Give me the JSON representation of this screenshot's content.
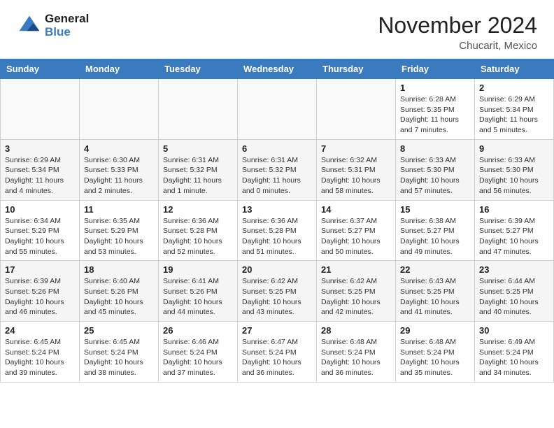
{
  "header": {
    "logo_general": "General",
    "logo_blue": "Blue",
    "month_title": "November 2024",
    "location": "Chucarit, Mexico"
  },
  "weekdays": [
    "Sunday",
    "Monday",
    "Tuesday",
    "Wednesday",
    "Thursday",
    "Friday",
    "Saturday"
  ],
  "weeks": [
    [
      {
        "day": "",
        "info": ""
      },
      {
        "day": "",
        "info": ""
      },
      {
        "day": "",
        "info": ""
      },
      {
        "day": "",
        "info": ""
      },
      {
        "day": "",
        "info": ""
      },
      {
        "day": "1",
        "info": "Sunrise: 6:28 AM\nSunset: 5:35 PM\nDaylight: 11 hours and 7 minutes."
      },
      {
        "day": "2",
        "info": "Sunrise: 6:29 AM\nSunset: 5:34 PM\nDaylight: 11 hours and 5 minutes."
      }
    ],
    [
      {
        "day": "3",
        "info": "Sunrise: 6:29 AM\nSunset: 5:34 PM\nDaylight: 11 hours and 4 minutes."
      },
      {
        "day": "4",
        "info": "Sunrise: 6:30 AM\nSunset: 5:33 PM\nDaylight: 11 hours and 2 minutes."
      },
      {
        "day": "5",
        "info": "Sunrise: 6:31 AM\nSunset: 5:32 PM\nDaylight: 11 hours and 1 minute."
      },
      {
        "day": "6",
        "info": "Sunrise: 6:31 AM\nSunset: 5:32 PM\nDaylight: 11 hours and 0 minutes."
      },
      {
        "day": "7",
        "info": "Sunrise: 6:32 AM\nSunset: 5:31 PM\nDaylight: 10 hours and 58 minutes."
      },
      {
        "day": "8",
        "info": "Sunrise: 6:33 AM\nSunset: 5:30 PM\nDaylight: 10 hours and 57 minutes."
      },
      {
        "day": "9",
        "info": "Sunrise: 6:33 AM\nSunset: 5:30 PM\nDaylight: 10 hours and 56 minutes."
      }
    ],
    [
      {
        "day": "10",
        "info": "Sunrise: 6:34 AM\nSunset: 5:29 PM\nDaylight: 10 hours and 55 minutes."
      },
      {
        "day": "11",
        "info": "Sunrise: 6:35 AM\nSunset: 5:29 PM\nDaylight: 10 hours and 53 minutes."
      },
      {
        "day": "12",
        "info": "Sunrise: 6:36 AM\nSunset: 5:28 PM\nDaylight: 10 hours and 52 minutes."
      },
      {
        "day": "13",
        "info": "Sunrise: 6:36 AM\nSunset: 5:28 PM\nDaylight: 10 hours and 51 minutes."
      },
      {
        "day": "14",
        "info": "Sunrise: 6:37 AM\nSunset: 5:27 PM\nDaylight: 10 hours and 50 minutes."
      },
      {
        "day": "15",
        "info": "Sunrise: 6:38 AM\nSunset: 5:27 PM\nDaylight: 10 hours and 49 minutes."
      },
      {
        "day": "16",
        "info": "Sunrise: 6:39 AM\nSunset: 5:27 PM\nDaylight: 10 hours and 47 minutes."
      }
    ],
    [
      {
        "day": "17",
        "info": "Sunrise: 6:39 AM\nSunset: 5:26 PM\nDaylight: 10 hours and 46 minutes."
      },
      {
        "day": "18",
        "info": "Sunrise: 6:40 AM\nSunset: 5:26 PM\nDaylight: 10 hours and 45 minutes."
      },
      {
        "day": "19",
        "info": "Sunrise: 6:41 AM\nSunset: 5:26 PM\nDaylight: 10 hours and 44 minutes."
      },
      {
        "day": "20",
        "info": "Sunrise: 6:42 AM\nSunset: 5:25 PM\nDaylight: 10 hours and 43 minutes."
      },
      {
        "day": "21",
        "info": "Sunrise: 6:42 AM\nSunset: 5:25 PM\nDaylight: 10 hours and 42 minutes."
      },
      {
        "day": "22",
        "info": "Sunrise: 6:43 AM\nSunset: 5:25 PM\nDaylight: 10 hours and 41 minutes."
      },
      {
        "day": "23",
        "info": "Sunrise: 6:44 AM\nSunset: 5:25 PM\nDaylight: 10 hours and 40 minutes."
      }
    ],
    [
      {
        "day": "24",
        "info": "Sunrise: 6:45 AM\nSunset: 5:24 PM\nDaylight: 10 hours and 39 minutes."
      },
      {
        "day": "25",
        "info": "Sunrise: 6:45 AM\nSunset: 5:24 PM\nDaylight: 10 hours and 38 minutes."
      },
      {
        "day": "26",
        "info": "Sunrise: 6:46 AM\nSunset: 5:24 PM\nDaylight: 10 hours and 37 minutes."
      },
      {
        "day": "27",
        "info": "Sunrise: 6:47 AM\nSunset: 5:24 PM\nDaylight: 10 hours and 36 minutes."
      },
      {
        "day": "28",
        "info": "Sunrise: 6:48 AM\nSunset: 5:24 PM\nDaylight: 10 hours and 36 minutes."
      },
      {
        "day": "29",
        "info": "Sunrise: 6:48 AM\nSunset: 5:24 PM\nDaylight: 10 hours and 35 minutes."
      },
      {
        "day": "30",
        "info": "Sunrise: 6:49 AM\nSunset: 5:24 PM\nDaylight: 10 hours and 34 minutes."
      }
    ]
  ]
}
